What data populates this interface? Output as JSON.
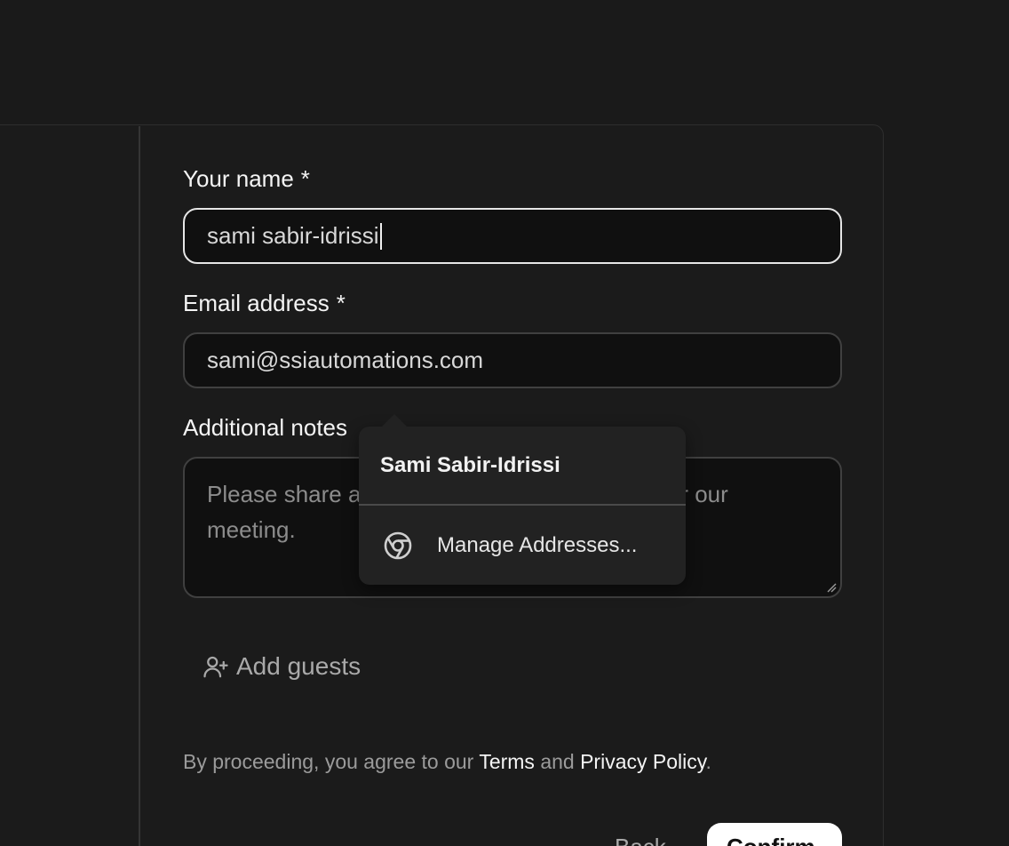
{
  "form": {
    "name_label": "Your name",
    "name_required": "*",
    "name_value": "sami sabir-idrissi",
    "email_label": "Email address",
    "email_required": "*",
    "email_value": "sami@ssiautomations.com",
    "notes_label": "Additional notes",
    "notes_placeholder": "Please share anything that will help prepare for our meeting.",
    "add_guests_label": "Add guests",
    "add_guests_icon": "user-plus-icon"
  },
  "legal": {
    "prefix": "By proceeding, you agree to our ",
    "terms_link": "Terms",
    "middle": " and ",
    "privacy_link": "Privacy Policy",
    "suffix": "."
  },
  "actions": {
    "back_label": "Back",
    "confirm_label": "Confirm"
  },
  "autofill_popup": {
    "suggestion_name": "Sami Sabir-Idrissi",
    "manage_label": "Manage Addresses...",
    "manage_icon": "chrome-icon"
  },
  "colors": {
    "background": "#1a1a1a",
    "input_background": "#101010",
    "focus_border": "#e6e6e6",
    "popup_background": "#222222",
    "confirm_background": "#ffffff"
  }
}
